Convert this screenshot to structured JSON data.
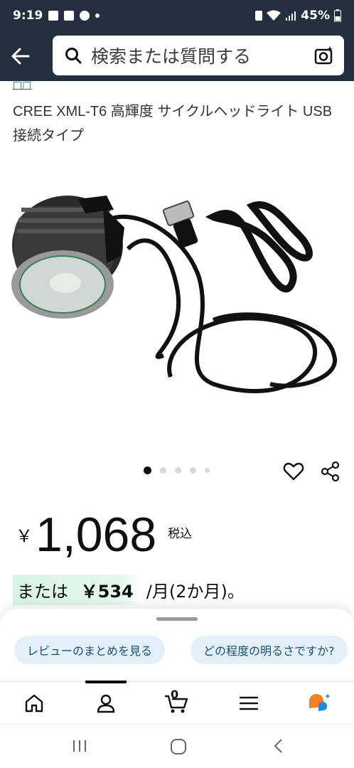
{
  "status_bar": {
    "time": "9:19",
    "battery": "45%"
  },
  "header": {
    "search_placeholder": "検索または質問する"
  },
  "product": {
    "brand_link": "□□",
    "title": "CREE XML-T6 高輝度 サイクルヘッドライト USB接続タイプ",
    "image_count": 5,
    "active_image": 1
  },
  "price": {
    "symbol": "￥",
    "value": "1,068",
    "tax_label": "税込"
  },
  "installment": {
    "prefix": "または",
    "amount": "￥534",
    "suffix": "/月(2か月)。"
  },
  "sheet": {
    "chips": [
      "レビューのまとめを見る",
      "どの程度の明るさですか?"
    ]
  },
  "bottom_nav": {
    "cart_count": "0",
    "items": [
      "home-icon",
      "account-icon",
      "cart-icon",
      "menu-icon",
      "rufus-icon"
    ]
  },
  "colors": {
    "header_bg": "#232f3e",
    "chip_bg": "#e3f0fa",
    "installment_bg": "#d8f3e8",
    "link": "#007185",
    "rufus_orange": "#f47f24",
    "rufus_blue": "#1e88e5"
  }
}
